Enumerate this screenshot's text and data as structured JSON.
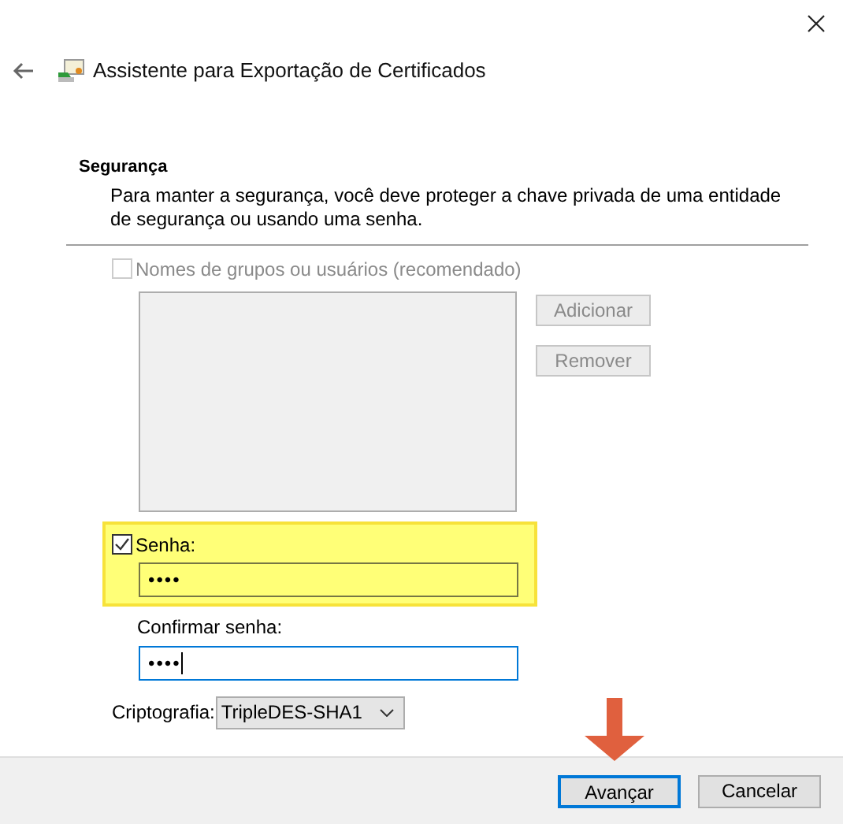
{
  "window": {
    "title": "Assistente para Exportação de Certificados"
  },
  "section": {
    "heading": "Segurança",
    "description": "Para manter a segurança, você deve proteger a chave privada de uma entidade de segurança ou usando uma senha."
  },
  "groups": {
    "label": "Nomes de grupos ou usuários (recomendado)",
    "checked": false,
    "disabled": true,
    "buttons": [
      {
        "label": "Adicionar",
        "disabled": true
      },
      {
        "label": "Remover",
        "disabled": true
      }
    ]
  },
  "password": {
    "label": "Senha:",
    "checked": true,
    "highlighted": true,
    "value": "••••",
    "confirm_label": "Confirmar senha:",
    "confirm_value": "••••",
    "confirm_focused": true
  },
  "encryption": {
    "label": "Criptografia:",
    "value": "TripleDES-SHA1"
  },
  "buttons": [
    {
      "label": "Avançar",
      "default": true
    },
    {
      "label": "Cancelar",
      "default": false
    }
  ]
}
